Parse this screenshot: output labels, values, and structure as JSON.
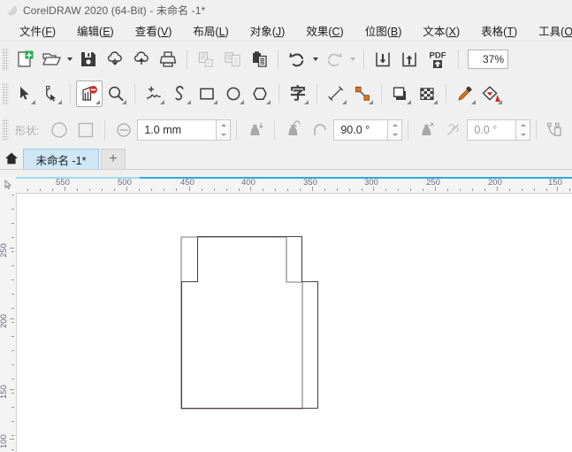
{
  "window": {
    "title": "CorelDRAW 2020 (64-Bit) - 未命名 -1*",
    "logo_icon": "coreldraw-balloon-icon"
  },
  "menubar": {
    "items": [
      {
        "name": "file",
        "label": "文件",
        "mnemonic": "F"
      },
      {
        "name": "edit",
        "label": "编辑",
        "mnemonic": "E"
      },
      {
        "name": "view",
        "label": "查看",
        "mnemonic": "V"
      },
      {
        "name": "layout",
        "label": "布局",
        "mnemonic": "L"
      },
      {
        "name": "object",
        "label": "对象",
        "mnemonic": "J"
      },
      {
        "name": "effects",
        "label": "效果",
        "mnemonic": "C"
      },
      {
        "name": "bitmaps",
        "label": "位图",
        "mnemonic": "B"
      },
      {
        "name": "text",
        "label": "文本",
        "mnemonic": "X"
      },
      {
        "name": "table",
        "label": "表格",
        "mnemonic": "T"
      },
      {
        "name": "tools",
        "label": "工具",
        "mnemonic": "O"
      }
    ]
  },
  "standard_toolbar": {
    "buttons": [
      {
        "name": "new-document-button",
        "icon": "new-page-icon"
      },
      {
        "name": "open-document-button",
        "icon": "open-folder-icon",
        "has_dropdown": true
      },
      {
        "name": "save-document-button",
        "icon": "floppy-disk-icon"
      },
      {
        "name": "download-cloud-button",
        "icon": "cloud-download-icon"
      },
      {
        "name": "upload-cloud-button",
        "icon": "cloud-upload-icon"
      },
      {
        "name": "print-button",
        "icon": "printer-icon"
      },
      {
        "name": "cut-button",
        "icon": "scissors-cut-icon",
        "disabled": true
      },
      {
        "name": "copy-button",
        "icon": "copy-pages-icon",
        "disabled": true
      },
      {
        "name": "paste-button",
        "icon": "clipboard-paste-icon"
      },
      {
        "name": "undo-button",
        "icon": "undo-arrow-icon",
        "has_dropdown": true
      },
      {
        "name": "redo-button",
        "icon": "redo-arrow-icon",
        "has_dropdown": true,
        "disabled": true
      },
      {
        "name": "import-button",
        "icon": "import-down-arrow-icon"
      },
      {
        "name": "export-button",
        "icon": "export-up-arrow-icon"
      },
      {
        "name": "publish-pdf-button",
        "icon": "pdf-icon"
      }
    ],
    "zoom_level": "37%"
  },
  "toolbox": {
    "tools": [
      {
        "name": "pick-tool",
        "icon": "arrow-cursor-icon",
        "selected": false
      },
      {
        "name": "shape-tool",
        "icon": "node-edit-icon",
        "selected": false
      },
      {
        "name": "crop-tool",
        "icon": "crop-blocked-icon",
        "selected": true
      },
      {
        "name": "zoom-tool",
        "icon": "magnifier-icon",
        "selected": false
      },
      {
        "name": "freehand-tool",
        "icon": "freehand-curve-icon",
        "selected": false
      },
      {
        "name": "artistic-media-tool",
        "icon": "artistic-media-icon",
        "selected": false
      },
      {
        "name": "rectangle-tool",
        "icon": "rectangle-icon",
        "selected": false
      },
      {
        "name": "ellipse-tool",
        "icon": "ellipse-icon",
        "selected": false
      },
      {
        "name": "polygon-tool",
        "icon": "polygon-icon",
        "selected": false
      },
      {
        "name": "text-tool",
        "icon": "text-character-icon",
        "selected": false,
        "glyph": "字"
      },
      {
        "name": "dimension-tool",
        "icon": "dimension-line-icon",
        "selected": false
      },
      {
        "name": "connector-tool",
        "icon": "connector-line-icon",
        "selected": false
      },
      {
        "name": "drop-shadow-tool",
        "icon": "drop-shadow-icon",
        "selected": false
      },
      {
        "name": "transparency-tool",
        "icon": "transparency-checker-icon",
        "selected": false
      },
      {
        "name": "color-eyedropper-tool",
        "icon": "eyedropper-icon",
        "selected": false
      },
      {
        "name": "interactive-fill-tool",
        "icon": "fill-bucket-icon",
        "selected": false
      }
    ]
  },
  "property_bar": {
    "shape_label": "形状:",
    "shape_round_button": "round-corner-icon",
    "shape_square_button": "square-corner-icon",
    "width_icon": "line-width-icon",
    "width_value": "1.0 mm",
    "flat_cap_icon": "flat-cap-icon",
    "round_cap_icon": "round-cap-icon",
    "angle_icon": "miter-angle-icon",
    "angle_value": "90.0 °",
    "bevel_icon": "bevel-join-icon",
    "slant_icon": "slant-angle-icon",
    "slant_value": "0.0 °",
    "outline_icon": "outline-pen-icon"
  },
  "tabbar": {
    "home_icon": "home-icon",
    "tabs": [
      {
        "name": "document-tab",
        "label": "未命名 -1*",
        "active": true
      }
    ],
    "new_tab_label": "+"
  },
  "rulers": {
    "corner_icon": "ruler-origin-icon",
    "unit": "px",
    "horizontal_labels": [
      "550",
      "500",
      "450",
      "400",
      "350",
      "300",
      "250",
      "200",
      "150"
    ],
    "vertical_labels": [
      "250",
      "200",
      "150",
      "100"
    ]
  },
  "canvas": {
    "object": {
      "name": "stepped-rectangle-path",
      "stroke_color": "#4a4246",
      "fill_color": "#ffffff",
      "description": "封闭折线：带凸起顶块的矩形"
    }
  },
  "colors": {
    "window_bg": "#f0f0f0",
    "accent_blue": "#2eaadc",
    "tab_active": "#cfe6f7",
    "canvas_white": "#ffffff",
    "icon_dark": "#3b3b3b",
    "icon_disabled": "#c3c3c3",
    "orange": "#e8751a",
    "green": "#22b14c",
    "red": "#d42b22"
  }
}
